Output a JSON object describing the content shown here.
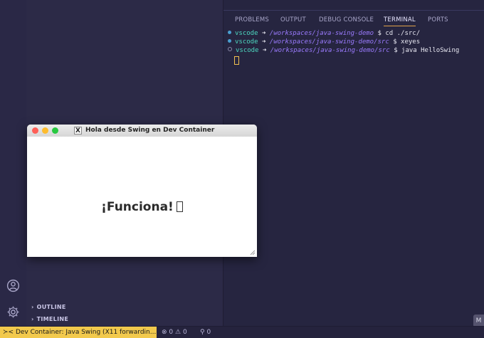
{
  "panel": {
    "tabs": [
      {
        "label": "PROBLEMS"
      },
      {
        "label": "OUTPUT"
      },
      {
        "label": "DEBUG CONSOLE"
      },
      {
        "label": "TERMINAL"
      },
      {
        "label": "PORTS"
      }
    ],
    "active_tab": "TERMINAL"
  },
  "terminal": {
    "lines": [
      {
        "user": "vscode",
        "arrow": "➜",
        "path": "/workspaces/java-swing-demo",
        "cmd": "$ cd ./src/"
      },
      {
        "user": "vscode",
        "arrow": "➜",
        "path": "/workspaces/java-swing-demo/src",
        "cmd": "$ xeyes"
      },
      {
        "user": "vscode",
        "arrow": "➜",
        "path": "/workspaces/java-swing-demo/src",
        "cmd": "$ java HelloSwing"
      }
    ]
  },
  "swing_window": {
    "title": "Hola desde Swing en Dev Container",
    "message": "¡Funciona!",
    "x11_icon": "X"
  },
  "sidebar": {
    "sections": [
      {
        "label": "OUTLINE"
      },
      {
        "label": "TIMELINE"
      }
    ]
  },
  "statusbar": {
    "remote_label": "Dev Container: Java Swing (X11 forwardin...",
    "errors": "0",
    "warnings": "0",
    "ports": "0"
  },
  "corner_button": "M",
  "colors": {
    "status_remote_bg": "#f2c94c",
    "terminal_user": "#4dd8c0",
    "terminal_path": "#9b7bff",
    "active_tab_underline": "#e0a34a"
  },
  "icons": [
    "account-icon",
    "settings-gear-icon",
    "remote-icon",
    "error-icon",
    "warning-icon",
    "ports-icon",
    "x11-icon",
    "chevron-right-icon",
    "resize-grip-icon"
  ]
}
